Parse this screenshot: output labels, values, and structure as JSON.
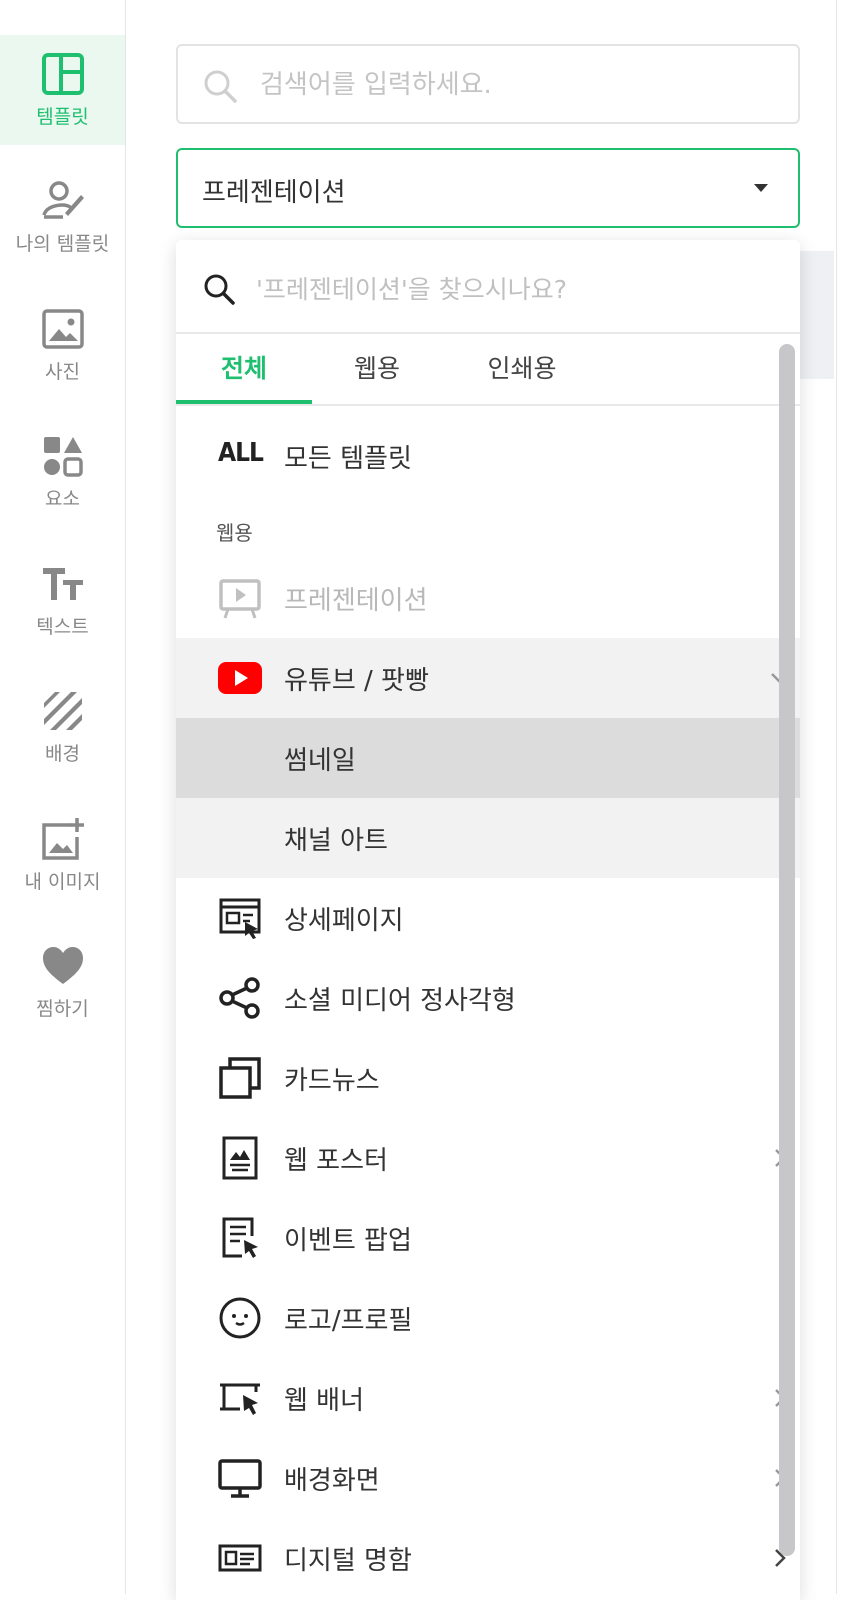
{
  "sidebar": {
    "items": [
      {
        "label": "템플릿",
        "icon": "template-icon",
        "active": true
      },
      {
        "label": "나의 템플릿",
        "icon": "my-template-icon"
      },
      {
        "label": "사진",
        "icon": "photo-icon"
      },
      {
        "label": "요소",
        "icon": "elements-icon"
      },
      {
        "label": "텍스트",
        "icon": "text-icon"
      },
      {
        "label": "배경",
        "icon": "background-icon"
      },
      {
        "label": "내 이미지",
        "icon": "my-image-icon"
      },
      {
        "label": "찜하기",
        "icon": "heart-icon"
      }
    ]
  },
  "search": {
    "placeholder": "검색어를 입력하세요."
  },
  "category_select": {
    "value": "프레젠테이션"
  },
  "dropdown": {
    "search_placeholder": "'프레젠테이션'을 찾으시나요?",
    "tabs": [
      "전체",
      "웹용",
      "인쇄용"
    ],
    "active_tab": "전체",
    "all_badge": "ALL",
    "all_label": "모든 템플릿",
    "section_web": "웹용",
    "items": [
      {
        "label": "프레젠테이션",
        "icon": "presentation-icon",
        "disabled": true
      },
      {
        "label": "유튜브 / 팟빵",
        "icon": "youtube-icon",
        "expanded": true
      },
      {
        "label": "썸네일",
        "sub": true,
        "selected": true
      },
      {
        "label": "채널 아트",
        "sub": true
      },
      {
        "label": "상세페이지",
        "icon": "detail-page-icon"
      },
      {
        "label": "소셜 미디어 정사각형",
        "icon": "share-icon"
      },
      {
        "label": "카드뉴스",
        "icon": "card-news-icon"
      },
      {
        "label": "웹 포스터",
        "icon": "web-poster-icon",
        "has_children": true
      },
      {
        "label": "이벤트 팝업",
        "icon": "event-popup-icon"
      },
      {
        "label": "로고/프로필",
        "icon": "logo-profile-icon"
      },
      {
        "label": "웹 배너",
        "icon": "web-banner-icon",
        "has_children": true
      },
      {
        "label": "배경화면",
        "icon": "monitor-icon",
        "has_children": true
      },
      {
        "label": "디지털 명함",
        "icon": "business-card-icon",
        "has_children": true
      }
    ]
  },
  "colors": {
    "accent": "#1fbf70",
    "youtube": "#ff0000",
    "selected_row": "#dcdcdc",
    "hover_row": "#f2f2f2"
  }
}
